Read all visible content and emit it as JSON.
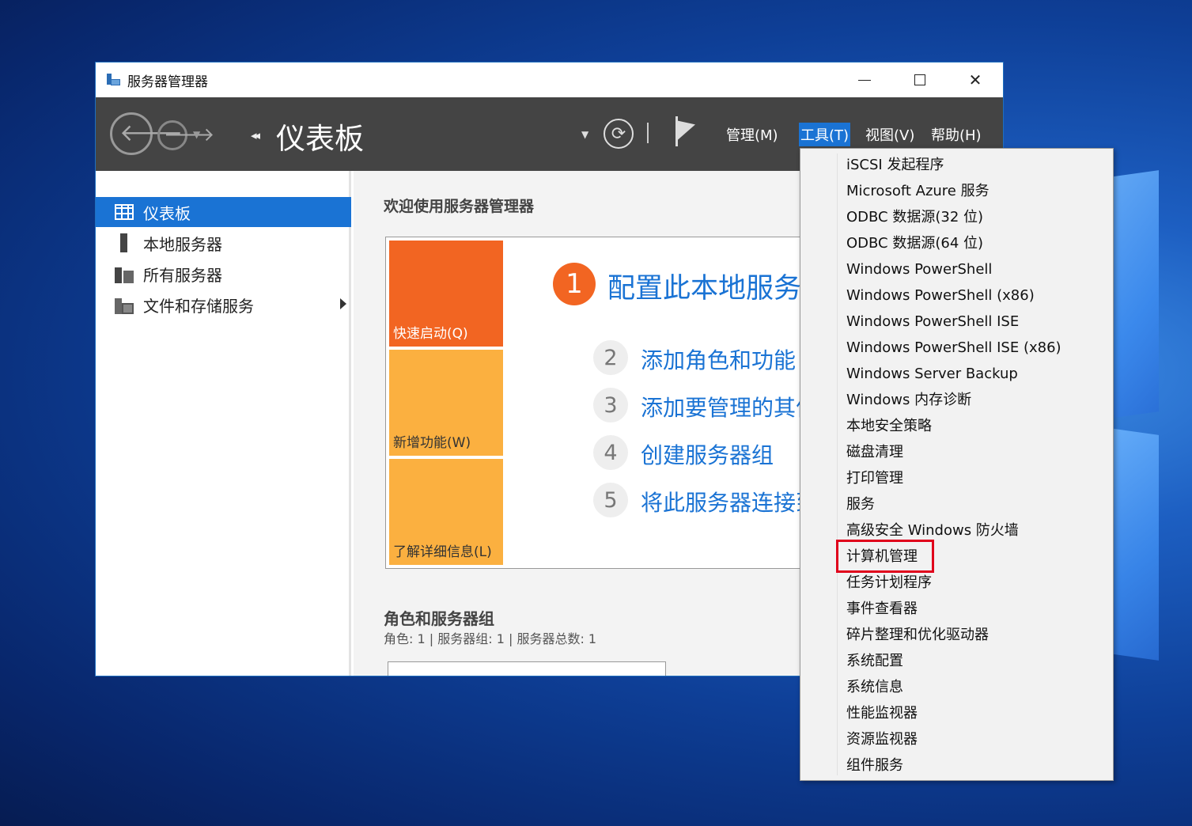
{
  "window": {
    "title": "服务器管理器"
  },
  "toolbar": {
    "breadcrumb_title": "仪表板",
    "menus": [
      "管理(M)",
      "工具(T)",
      "视图(V)",
      "帮助(H)"
    ]
  },
  "sidebar": {
    "items": [
      {
        "label": "仪表板",
        "active": true
      },
      {
        "label": "本地服务器"
      },
      {
        "label": "所有服务器"
      },
      {
        "label": "文件和存储服务"
      }
    ]
  },
  "main": {
    "welcome_title": "欢迎使用服务器管理器",
    "tiles": [
      "快速启动(Q)",
      "新增功能(W)",
      "了解详细信息(L)"
    ],
    "steps": [
      {
        "num": "1",
        "text": "配置此本地服务"
      },
      {
        "num": "2",
        "text": "添加角色和功能"
      },
      {
        "num": "3",
        "text": "添加要管理的其何"
      },
      {
        "num": "4",
        "text": "创建服务器组"
      },
      {
        "num": "5",
        "text": "将此服务器连接到"
      }
    ],
    "roles_title": "角色和服务器组",
    "roles_summary": "角色: 1 | 服务器组: 1 | 服务器总数: 1"
  },
  "tools_menu": {
    "items": [
      "iSCSI 发起程序",
      "Microsoft Azure 服务",
      "ODBC 数据源(32 位)",
      "ODBC 数据源(64 位)",
      "Windows PowerShell",
      "Windows PowerShell (x86)",
      "Windows PowerShell ISE",
      "Windows PowerShell ISE (x86)",
      "Windows Server Backup",
      "Windows 内存诊断",
      "本地安全策略",
      "磁盘清理",
      "打印管理",
      "服务",
      "高级安全 Windows 防火墙",
      "计算机管理",
      "任务计划程序",
      "事件查看器",
      "碎片整理和优化驱动器",
      "系统配置",
      "系统信息",
      "性能监视器",
      "资源监视器",
      "组件服务"
    ],
    "highlighted": "计算机管理"
  },
  "colors": {
    "accent": "#1a73d4",
    "toolbar_bg": "#444444",
    "tile_orange": "#f26522",
    "tile_yellow": "#fbb040",
    "highlight_red": "#e0001b"
  }
}
